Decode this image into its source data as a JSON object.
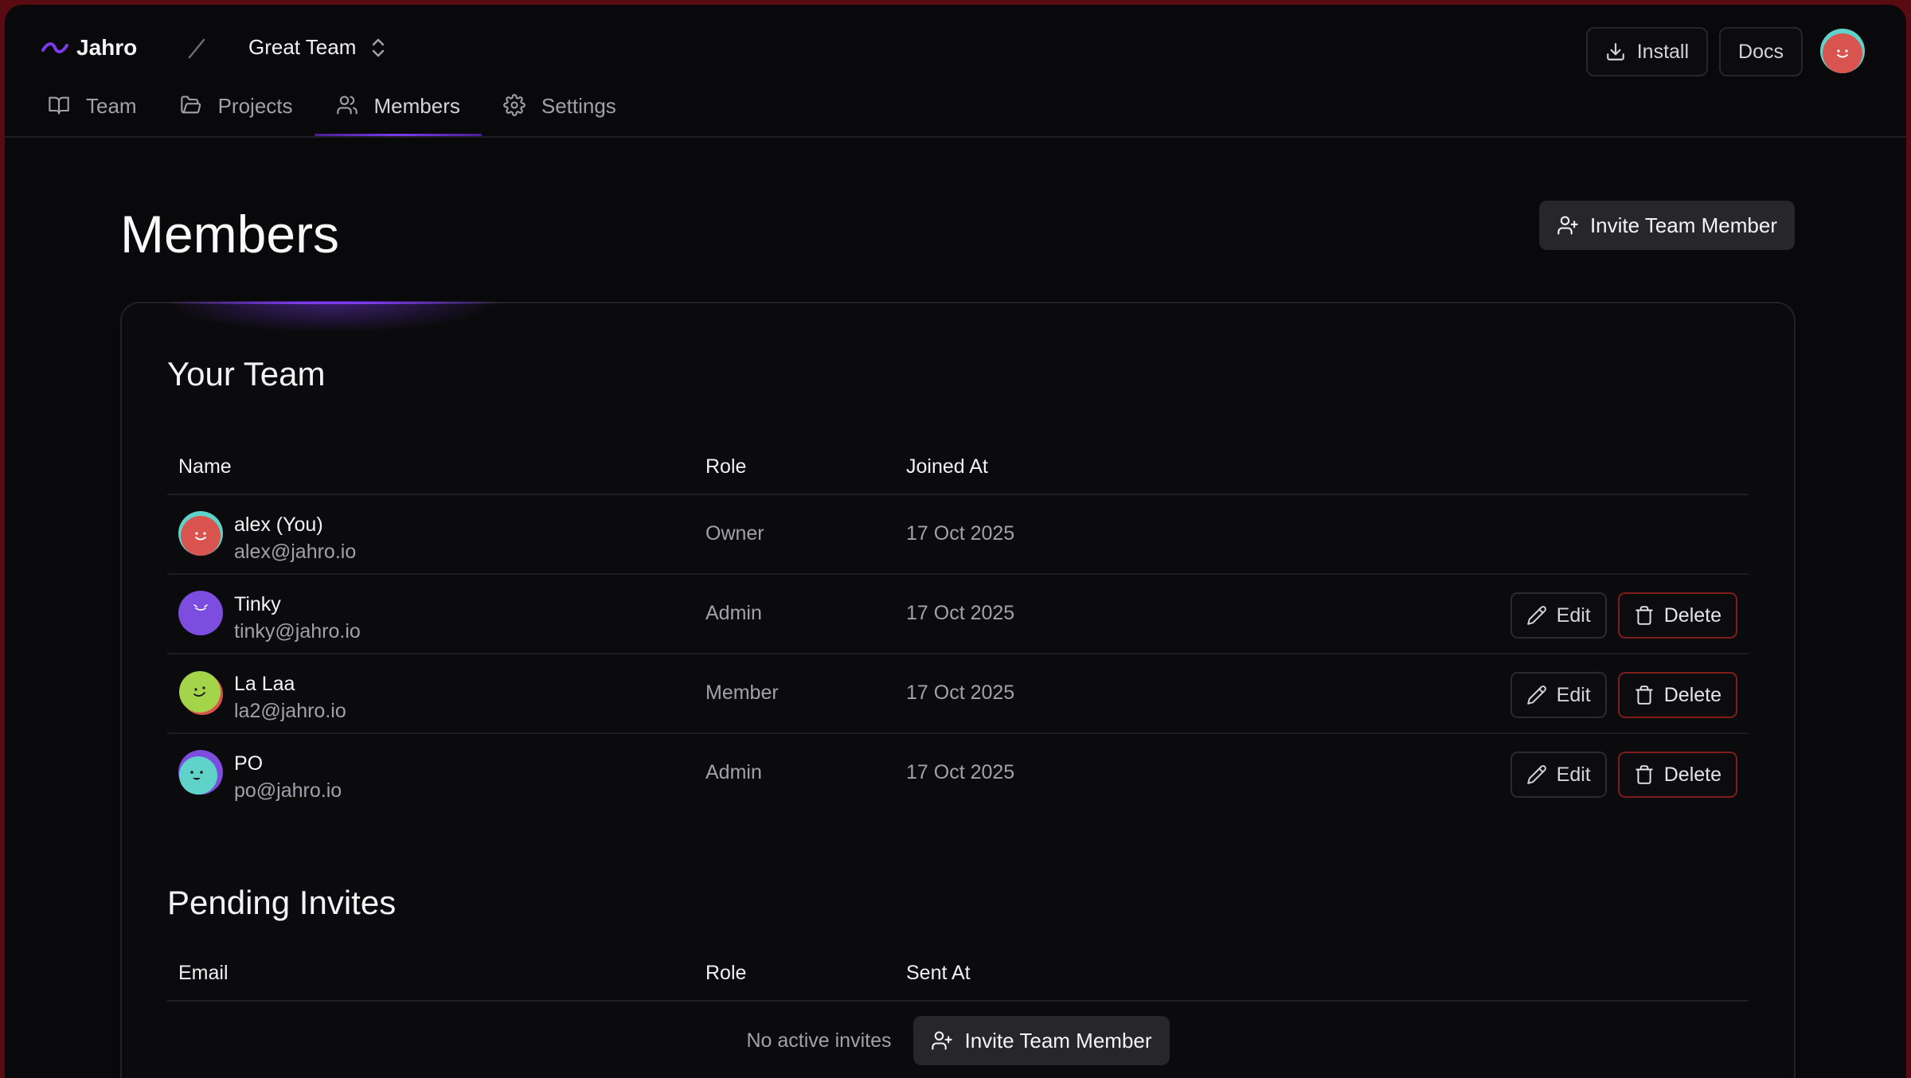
{
  "app": {
    "brand": "Jahro",
    "team": "Great Team"
  },
  "top_actions": {
    "install": "Install",
    "docs": "Docs"
  },
  "tabs": [
    {
      "label": "Team",
      "icon": "book-icon"
    },
    {
      "label": "Projects",
      "icon": "folder-icon"
    },
    {
      "label": "Members",
      "icon": "users-icon",
      "active": true
    },
    {
      "label": "Settings",
      "icon": "gear-icon"
    }
  ],
  "page": {
    "title": "Members",
    "invite_label": "Invite Team Member"
  },
  "team": {
    "title": "Your Team",
    "columns": {
      "name": "Name",
      "role": "Role",
      "joined": "Joined At"
    },
    "members": [
      {
        "name": "alex (You)",
        "email": "alex@jahro.io",
        "role": "Owner",
        "joined": "17 Oct 2025",
        "avatar_color": "#d9534f"
      },
      {
        "name": "Tinky",
        "email": "tinky@jahro.io",
        "role": "Admin",
        "joined": "17 Oct 2025",
        "avatar_color": "#7c4dde"
      },
      {
        "name": "La Laa",
        "email": "la2@jahro.io",
        "role": "Member",
        "joined": "17 Oct 2025",
        "avatar_color": "#a3d44a"
      },
      {
        "name": "PO",
        "email": "po@jahro.io",
        "role": "Admin",
        "joined": "17 Oct 2025",
        "avatar_color": "#5fd3c9"
      }
    ],
    "edit_label": "Edit",
    "delete_label": "Delete"
  },
  "invites": {
    "title": "Pending Invites",
    "columns": {
      "email": "Email",
      "role": "Role",
      "sent": "Sent At"
    },
    "empty_text": "No active invites",
    "invite_label": "Invite Team Member"
  },
  "colors": {
    "accent": "#7c3aed",
    "background": "#09090b",
    "danger_border": "#7f1d1d"
  }
}
